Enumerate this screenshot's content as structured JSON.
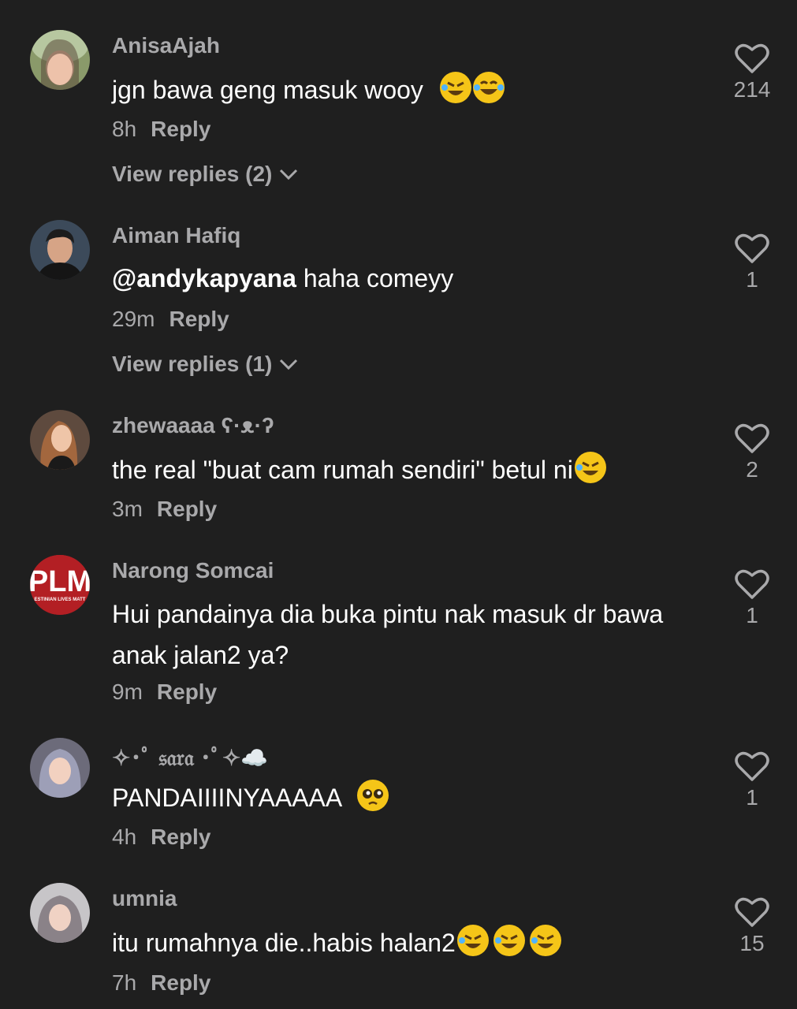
{
  "comments": [
    {
      "username": "AnisaAjah",
      "text": "jgn bawa geng masuk wooy",
      "emojis": [
        "rofl",
        "joy"
      ],
      "time": "8h",
      "reply": "Reply",
      "view_replies": "View replies (2)",
      "likes": "214"
    },
    {
      "username": "Aiman Hafiq",
      "mention": "@andykapyana",
      "text": " haha comeyy",
      "time": "29m",
      "reply": "Reply",
      "view_replies": "View replies (1)",
      "likes": "1"
    },
    {
      "username": "zhewaaaa ʕ·ᴥ·ʔ",
      "text": "the real \"buat cam rumah sendiri\" betul ni",
      "emojis": [
        "rofl"
      ],
      "time": "3m",
      "reply": "Reply",
      "likes": "2"
    },
    {
      "username": "Narong Somcai",
      "avatar_text": "PLM",
      "avatar_subtext": "ESTINIAN LIVES MATT",
      "text": "Hui pandainya dia buka pintu nak masuk dr bawa anak jalan2 ya?",
      "time": "9m",
      "reply": "Reply",
      "likes": "1"
    },
    {
      "username": "✧･ﾟ 𝔰𝔞𝔯𝔞 ･ﾟ✧☁️",
      "text": "PANDAIIIINYAAAAA",
      "emojis": [
        "pleading"
      ],
      "time": "4h",
      "reply": "Reply",
      "likes": "1"
    },
    {
      "username": "umnia",
      "text": "itu rumahnya die..habis halan2",
      "emojis": [
        "rofl",
        "rofl",
        "rofl"
      ],
      "time": "7h",
      "reply": "Reply",
      "likes": "15"
    }
  ],
  "colors": {
    "background": "#1f1f1f",
    "secondary_text": "#a9a9ab",
    "primary_text": "#ffffff"
  }
}
